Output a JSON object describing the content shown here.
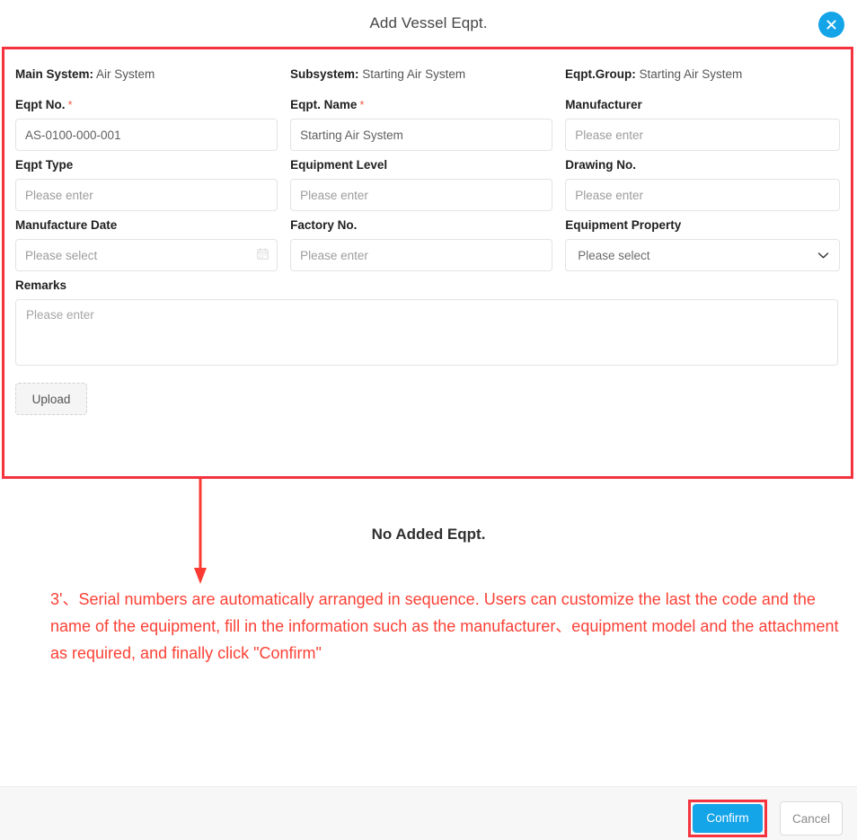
{
  "header": {
    "title": "Add Vessel Eqpt.",
    "close_icon": "close-icon"
  },
  "info": [
    {
      "label": "Main System:",
      "value": "Air System"
    },
    {
      "label": "Subsystem:",
      "value": "Starting Air System"
    },
    {
      "label": "Eqpt.Group:",
      "value": "Starting Air System"
    }
  ],
  "fields": {
    "eqpt_no": {
      "label": "Eqpt No.",
      "required": "*",
      "value": "AS-0100-000-001"
    },
    "eqpt_name": {
      "label": "Eqpt. Name",
      "required": "*",
      "value": "Starting Air System"
    },
    "manufacturer": {
      "label": "Manufacturer",
      "placeholder": "Please enter"
    },
    "eqpt_type": {
      "label": "Eqpt Type",
      "placeholder": "Please enter"
    },
    "equipment_level": {
      "label": "Equipment Level",
      "placeholder": "Please enter"
    },
    "drawing_no": {
      "label": "Drawing No.",
      "placeholder": "Please enter"
    },
    "manufacture_date": {
      "label": "Manufacture Date",
      "placeholder": "Please select",
      "icon": "calendar-icon"
    },
    "factory_no": {
      "label": "Factory No.",
      "placeholder": "Please enter"
    },
    "equipment_property": {
      "label": "Equipment Property",
      "placeholder": "Please select",
      "icon": "chevron-down-icon"
    },
    "remarks": {
      "label": "Remarks",
      "placeholder": "Please enter"
    }
  },
  "upload": {
    "label": "Upload"
  },
  "empty_state": {
    "text": "No Added Eqpt."
  },
  "annotation": {
    "text": "3'、Serial numbers are automatically arranged in sequence. Users can customize the last the code and the name of the equipment, fill in the information such as the manufacturer、equipment model and the attachment as required, and finally click \"Confirm\""
  },
  "footer": {
    "confirm": "Confirm",
    "cancel": "Cancel"
  },
  "colors": {
    "accent_blue": "#14a4e8",
    "annotation_red": "#fb4136",
    "highlight_red": "#f5333f",
    "required_star": "#f25c48"
  }
}
